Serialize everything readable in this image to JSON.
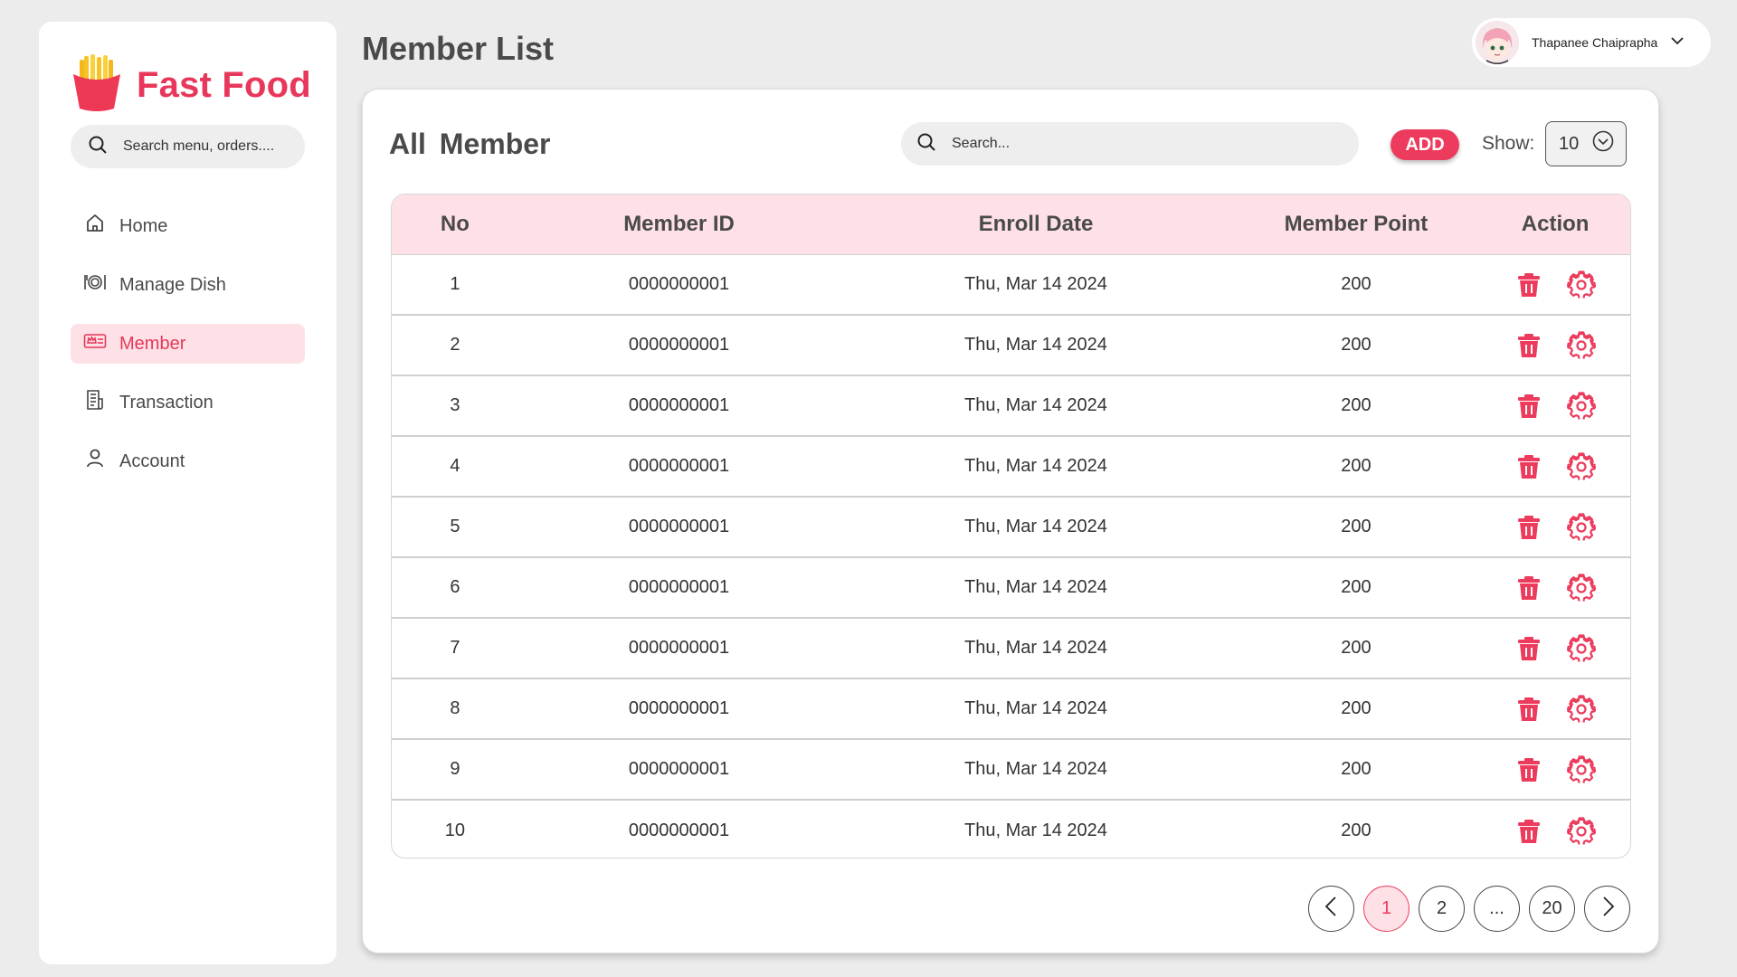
{
  "brand": {
    "name": "Fast Food"
  },
  "sidebar": {
    "search_placeholder": "Search menu, orders....",
    "items": [
      {
        "label": "Home",
        "icon": "home-icon"
      },
      {
        "label": "Manage Dish",
        "icon": "dish-icon"
      },
      {
        "label": "Member",
        "icon": "member-card-icon",
        "active": true
      },
      {
        "label": "Transaction",
        "icon": "receipt-icon"
      },
      {
        "label": "Account",
        "icon": "user-icon"
      }
    ]
  },
  "header": {
    "title": "Member List",
    "user_name": "Thapanee Chaiprapha"
  },
  "main": {
    "title": "All  Member",
    "search_placeholder": "Search...",
    "add_label": "ADD",
    "show_label": "Show:",
    "show_value": "10"
  },
  "table": {
    "columns": [
      "No",
      "Member ID",
      "Enroll Date",
      "Member Point",
      "Action"
    ],
    "rows": [
      {
        "no": "1",
        "member_id": "0000000001",
        "enroll_date": "Thu, Mar 14 2024",
        "points": "200"
      },
      {
        "no": "2",
        "member_id": "0000000001",
        "enroll_date": "Thu, Mar 14 2024",
        "points": "200"
      },
      {
        "no": "3",
        "member_id": "0000000001",
        "enroll_date": "Thu, Mar 14 2024",
        "points": "200"
      },
      {
        "no": "4",
        "member_id": "0000000001",
        "enroll_date": "Thu, Mar 14 2024",
        "points": "200"
      },
      {
        "no": "5",
        "member_id": "0000000001",
        "enroll_date": "Thu, Mar 14 2024",
        "points": "200"
      },
      {
        "no": "6",
        "member_id": "0000000001",
        "enroll_date": "Thu, Mar 14 2024",
        "points": "200"
      },
      {
        "no": "7",
        "member_id": "0000000001",
        "enroll_date": "Thu, Mar 14 2024",
        "points": "200"
      },
      {
        "no": "8",
        "member_id": "0000000001",
        "enroll_date": "Thu, Mar 14 2024",
        "points": "200"
      },
      {
        "no": "9",
        "member_id": "0000000001",
        "enroll_date": "Thu, Mar 14 2024",
        "points": "200"
      },
      {
        "no": "10",
        "member_id": "0000000001",
        "enroll_date": "Thu, Mar 14 2024",
        "points": "200"
      }
    ]
  },
  "pagination": {
    "pages": [
      "1",
      "2",
      "...",
      "20"
    ],
    "current": "1"
  },
  "colors": {
    "accent": "#ec3b5c",
    "accent_light": "#fde1e6",
    "background": "#ececec",
    "card": "#ffffff"
  }
}
